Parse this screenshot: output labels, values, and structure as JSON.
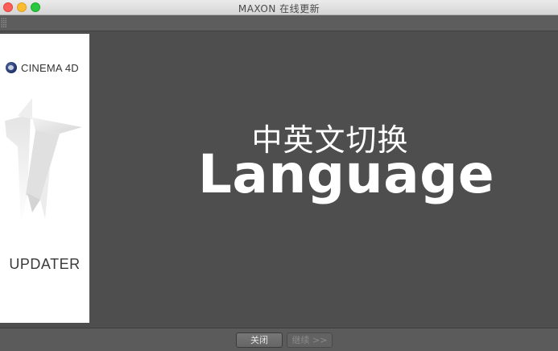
{
  "window": {
    "title": "MAXON 在线更新"
  },
  "banner": {
    "logo_text": "CINEMA 4D",
    "product_label": "UPDATER"
  },
  "content": {
    "chinese_heading": "中英文切换",
    "english_heading": "Language"
  },
  "buttons": {
    "close_label": "关闭",
    "next_label": "继续 >>"
  },
  "colors": {
    "background": "#4e4e4e",
    "banner": "#ffffff",
    "close_dot": "#fc5f57",
    "minimize_dot": "#fdbc2e",
    "maximize_dot": "#29c840"
  },
  "icons": [
    "close-dot-icon",
    "minimize-dot-icon",
    "maximize-dot-icon",
    "grip-icon",
    "cinema4d-logo-icon",
    "version-17-graphic-icon"
  ]
}
